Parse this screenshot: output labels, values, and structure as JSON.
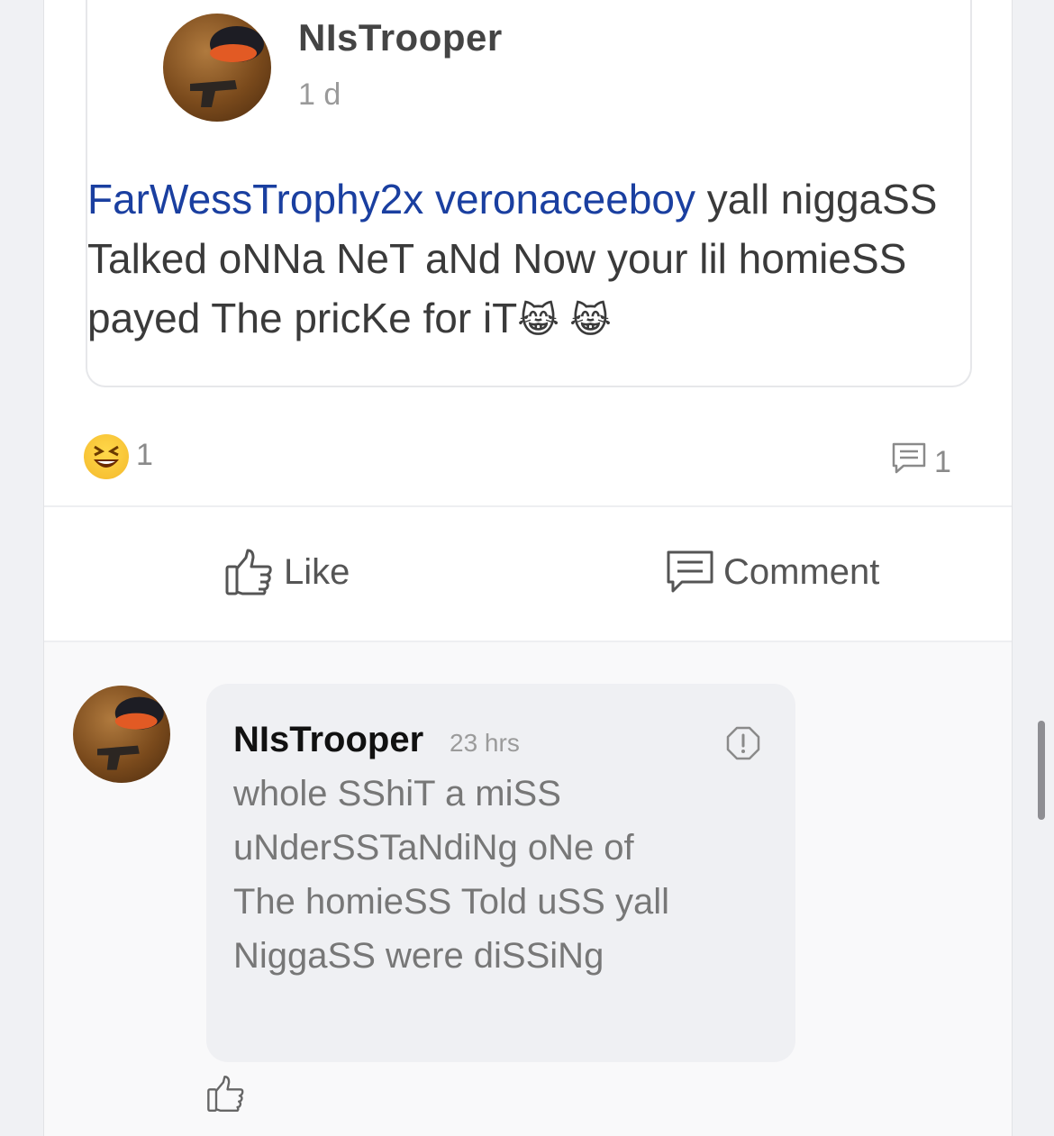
{
  "post": {
    "author": "NIsTrooper",
    "time": "1 d",
    "mentions": [
      "FarWessTrophy2x",
      "veronaceeboy"
    ],
    "body": " yall niggaSS Talked oNNa NeT aNd Now your lil homieSS payed The pricKe for iT",
    "emojis": "😹 😹"
  },
  "stats": {
    "reaction_icon": "laughing-emoji-icon",
    "reaction_count": "1",
    "comment_icon": "comment-icon",
    "comment_count": "1"
  },
  "actions": {
    "like_label": "Like",
    "comment_label": "Comment"
  },
  "comment": {
    "author": "NIsTrooper",
    "time": "23 hrs",
    "text": "whole SShiT a miSS uNderSSTaNdiNg oNe of The homieSS Told uSS yall NiggaSS were diSSiNg"
  },
  "colors": {
    "mention": "#1a3fa0",
    "text": "#3a3a3a",
    "muted": "#9a9a9a",
    "bubble": "#eff0f3"
  }
}
